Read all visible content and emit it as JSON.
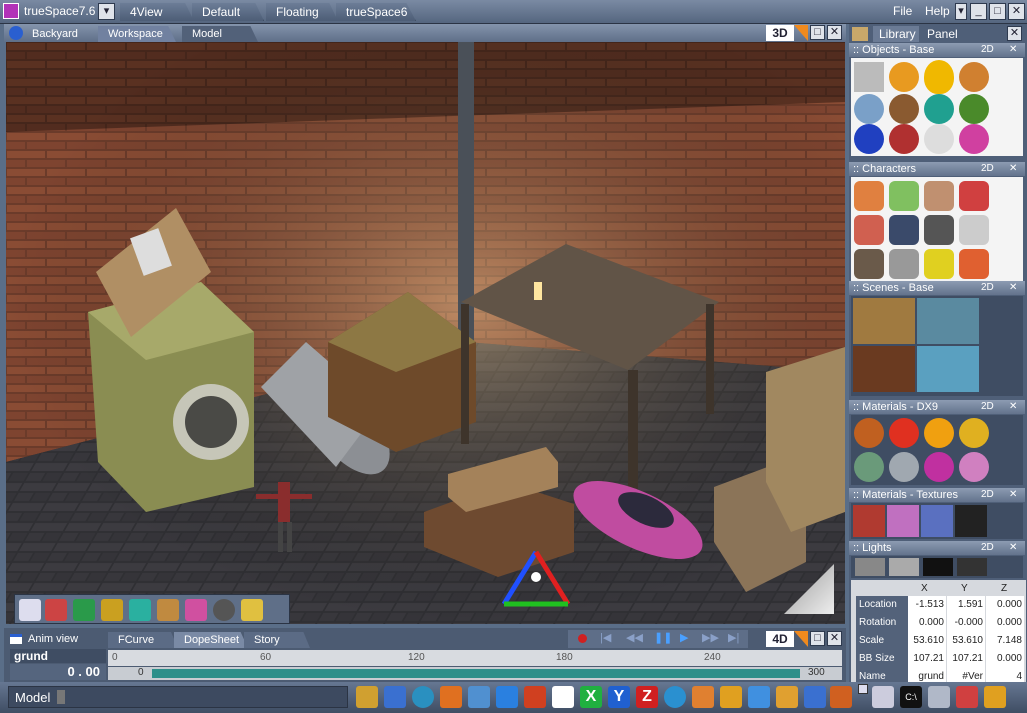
{
  "titlebar": {
    "app_title": "trueSpace7.6",
    "tabs": [
      "4View",
      "Default",
      "Floating",
      "trueSpace6"
    ],
    "file_label": "File",
    "help_label": "Help"
  },
  "viewport": {
    "tabs": [
      "Backyard",
      "Workspace",
      "Model"
    ],
    "mode_label": "3D"
  },
  "library": {
    "tabs": [
      "Library",
      "Panel"
    ],
    "sections": [
      {
        "title": ":: Objects - Base",
        "badge": "2D"
      },
      {
        "title": ":: Characters",
        "badge": "2D"
      },
      {
        "title": ":: Scenes - Base",
        "badge": "2D"
      },
      {
        "title": ":: Materials - DX9",
        "badge": "2D"
      },
      {
        "title": ":: Materials - Textures",
        "badge": "2D"
      },
      {
        "title": ":: Lights",
        "badge": "2D"
      }
    ]
  },
  "properties": {
    "headers": [
      "X",
      "Y",
      "Z"
    ],
    "rows": [
      {
        "label": "Location",
        "values": [
          "-1.513",
          "1.591",
          "0.000"
        ]
      },
      {
        "label": "Rotation",
        "values": [
          "0.000",
          "-0.000",
          "0.000"
        ]
      },
      {
        "label": "Scale",
        "values": [
          "53.610",
          "53.610",
          "7.148"
        ]
      },
      {
        "label": "BB Size",
        "values": [
          "107.21",
          "107.21",
          "0.000"
        ]
      },
      {
        "label": "Name",
        "values": [
          "grund",
          "#Ver",
          "4"
        ]
      }
    ]
  },
  "anim": {
    "title": "Anim view",
    "tabs": [
      "FCurve",
      "DopeSheet",
      "Story"
    ],
    "object_name": "grund",
    "time_value": "0 . 00",
    "ruler_ticks": [
      "0",
      "60",
      "120",
      "180",
      "240"
    ],
    "end_frame": "300",
    "start_frame": "0",
    "mode_label": "4D"
  },
  "status": {
    "mode": "Model"
  },
  "colors": {
    "accent": "#f08a1e",
    "panel": "#4f5f78",
    "track": "#2d8f8a"
  }
}
